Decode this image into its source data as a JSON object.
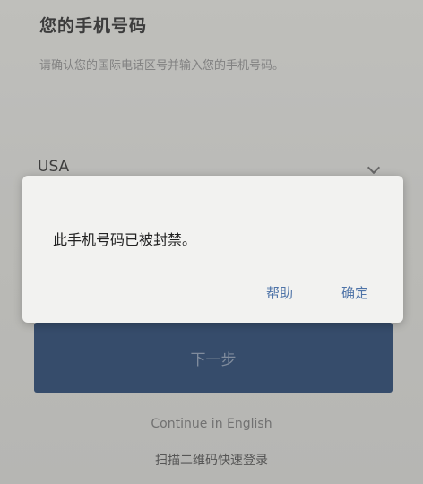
{
  "page": {
    "title": "您的手机号码",
    "subtitle": "请确认您的国际电话区号并输入您的手机号码。"
  },
  "country": {
    "selected": "USA",
    "chevron_icon": "chevron-down-icon"
  },
  "next_button": {
    "label": "下一步"
  },
  "links": {
    "continue_english": "Continue in English",
    "qr_login": "扫描二维码快速登录"
  },
  "dialog": {
    "message": "此手机号码已被封禁。",
    "help_label": "帮助",
    "ok_label": "确定"
  },
  "colors": {
    "background": "#d6d6d2",
    "primary_button": "#334e73",
    "dialog_button_text": "#4f74a8",
    "dialog_background": "#f2f2f0"
  }
}
